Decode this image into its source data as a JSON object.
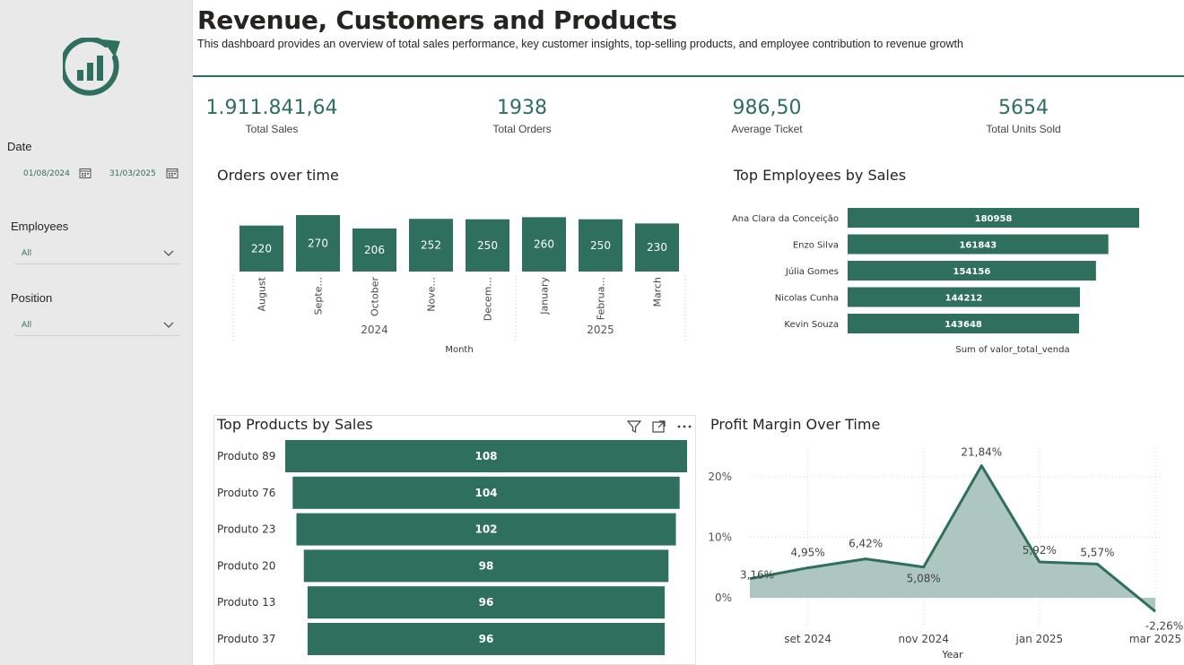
{
  "header": {
    "title": "Revenue, Customers and Products",
    "subtitle": "This dashboard provides an overview of total sales performance, key customer insights, top-selling products, and employee contribution to revenue growth"
  },
  "sidebar": {
    "logo_icon": "growth-chart-icon",
    "date": {
      "label": "Date",
      "start": "01/08/2024",
      "end": "31/03/2025"
    },
    "employees": {
      "label": "Employees",
      "value": "All"
    },
    "position": {
      "label": "Position",
      "value": "All"
    }
  },
  "kpis": [
    {
      "value": "1.911.841,64",
      "label": "Total Sales"
    },
    {
      "value": "1938",
      "label": "Total Orders"
    },
    {
      "value": "986,50",
      "label": "Average Ticket"
    },
    {
      "value": "5654",
      "label": "Total Units Sold"
    }
  ],
  "colors": {
    "accent": "#2f6f5e",
    "area": "#a9c3bc",
    "sidebar": "#e9e9e9"
  },
  "chart_data": [
    {
      "type": "bar",
      "title": "Orders over time",
      "categories": [
        "August",
        "Septe...",
        "October",
        "Nove...",
        "Decem...",
        "January",
        "Februa...",
        "March"
      ],
      "groups": [
        {
          "label": "2024",
          "from": 0,
          "to": 4
        },
        {
          "label": "2025",
          "from": 5,
          "to": 7
        }
      ],
      "values": [
        220,
        270,
        206,
        252,
        250,
        260,
        250,
        230
      ],
      "xlabel": "Month"
    },
    {
      "type": "bar",
      "orientation": "horizontal",
      "title": "Top Employees by Sales",
      "categories": [
        "Ana Clara da Conceição",
        "Enzo Silva",
        "Júlia Gomes",
        "Nicolas Cunha",
        "Kevin Souza"
      ],
      "values": [
        180958,
        161843,
        154156,
        144212,
        143648
      ],
      "xlabel": "Sum of valor_total_venda"
    },
    {
      "type": "bar",
      "orientation": "horizontal-funnel",
      "title": "Top Products by Sales",
      "categories": [
        "Produto 89",
        "Produto 76",
        "Produto 23",
        "Produto 20",
        "Produto 13",
        "Produto 37"
      ],
      "values": [
        108,
        104,
        102,
        98,
        96,
        96
      ]
    },
    {
      "type": "area",
      "title": "Profit Margin Over Time",
      "x": [
        "ago 2024",
        "set 2024",
        "out 2024",
        "nov 2024",
        "dez 2024",
        "jan 2025",
        "fev 2025",
        "mar 2025"
      ],
      "values": [
        3.16,
        4.95,
        6.42,
        5.08,
        21.84,
        5.92,
        5.57,
        -2.26
      ],
      "labels": [
        "3,16%",
        "4,95%",
        "6,42%",
        "5,08%",
        "21,84%",
        "5,92%",
        "5,57%",
        "-2,26%"
      ],
      "xticks": [
        "set 2024",
        "nov 2024",
        "jan 2025",
        "mar 2025"
      ],
      "yticks": [
        "0%",
        "10%",
        "20%"
      ],
      "xlabel": "Year"
    }
  ]
}
